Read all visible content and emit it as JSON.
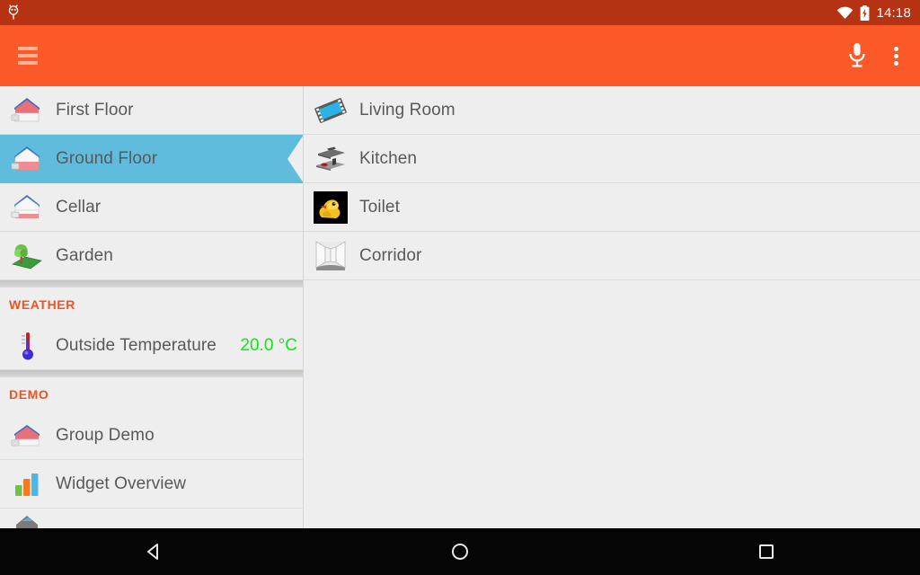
{
  "statusbar": {
    "debug_icon": "android-debug-icon",
    "wifi_icon": "wifi-icon",
    "battery_icon": "battery-charging-icon",
    "clock": "14:18"
  },
  "toolbar": {
    "menu_icon": "hamburger-menu-icon",
    "mic_icon": "microphone-icon",
    "overflow_icon": "overflow-menu-icon",
    "title": "",
    "background_color": "#fb5927"
  },
  "colors": {
    "status_bar": "#b53312",
    "accent": "#f4511e",
    "selected_row": "#5fbcdc",
    "value_green": "#11e511",
    "page_background": "#eeeeee"
  },
  "left_pane": {
    "items": [
      {
        "label": "First Floor",
        "icon": "house-first-floor-icon",
        "selected": false
      },
      {
        "label": "Ground Floor",
        "icon": "house-ground-floor-icon",
        "selected": true
      },
      {
        "label": "Cellar",
        "icon": "house-cellar-icon",
        "selected": false
      },
      {
        "label": "Garden",
        "icon": "garden-tree-icon",
        "selected": false
      }
    ],
    "sections": [
      {
        "header": "WEATHER",
        "items": [
          {
            "label": "Outside Temperature",
            "icon": "thermometer-icon",
            "value": "20.0 °C"
          }
        ]
      },
      {
        "header": "DEMO",
        "items": [
          {
            "label": "Group Demo",
            "icon": "house-group-demo-icon"
          },
          {
            "label": "Widget Overview",
            "icon": "bar-chart-icon"
          },
          {
            "label": "",
            "icon": "partial-item-icon"
          }
        ]
      }
    ]
  },
  "right_pane": {
    "items": [
      {
        "label": "Living Room",
        "icon": "film-strip-icon"
      },
      {
        "label": "Kitchen",
        "icon": "stove-icon"
      },
      {
        "label": "Toilet",
        "icon": "rubber-duck-icon"
      },
      {
        "label": "Corridor",
        "icon": "corridor-icon"
      }
    ]
  },
  "navbar": {
    "back": "back-triangle-icon",
    "home": "home-circle-icon",
    "recents": "recents-square-icon"
  }
}
